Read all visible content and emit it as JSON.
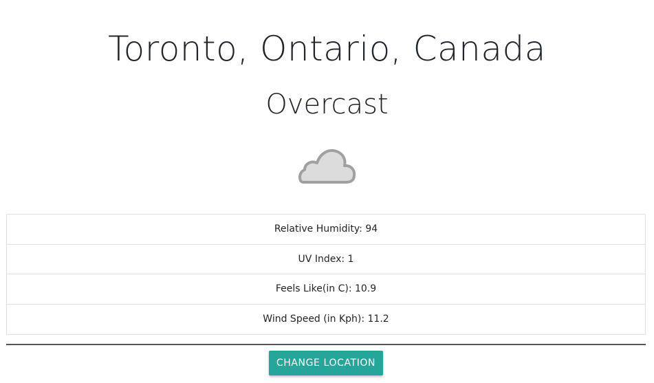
{
  "location": {
    "title": "Toronto, Ontario, Canada"
  },
  "weather": {
    "condition": "Overcast",
    "icon": "cloud-icon"
  },
  "details": [
    {
      "label": "Relative Humidity: 94"
    },
    {
      "label": "UV Index: 1"
    },
    {
      "label": "Feels Like(in C): 10.9"
    },
    {
      "label": "Wind Speed (in Kph): 11.2"
    }
  ],
  "actions": {
    "change_location_label": "Change Location"
  },
  "colors": {
    "accent": "#26a69a",
    "divider": "#555555",
    "icon_stroke": "#a0a0a0",
    "icon_fill": "#dcdcdc"
  }
}
